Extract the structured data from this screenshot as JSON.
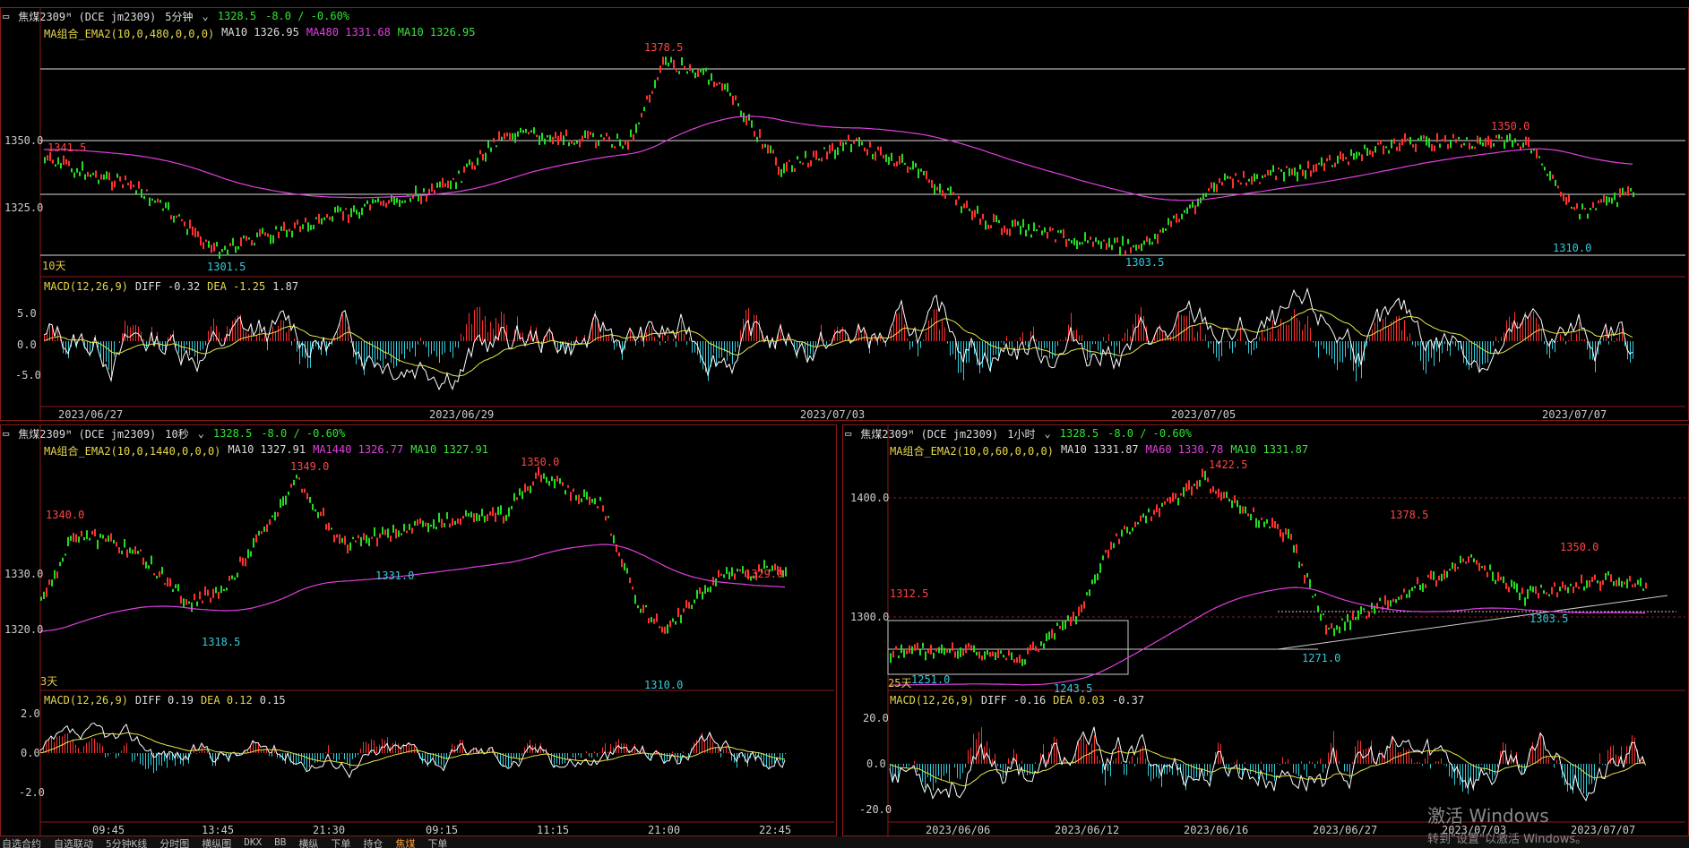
{
  "top": {
    "symbol": "焦煤2309ᴹ (DCE jm2309)",
    "period": "5分钟",
    "price": "1328.5",
    "change": "-8.0 / -0.60%",
    "legend": {
      "name": "MA组合_EMA2(10,0,480,0,0,0)",
      "ma10a": "MA10 1326.95",
      "ma480": "MA480 1331.68",
      "ma10b": "MA10 1326.95"
    },
    "yticks": [
      "1350.0",
      "1325.0"
    ],
    "annotations": {
      "high": "1378.5",
      "left": "1341.5",
      "low1": "1301.5",
      "low2": "1303.5",
      "r2": "1350.0",
      "last": "1310.0"
    },
    "days": "10天",
    "macd": {
      "name": "MACD(12,26,9)",
      "diff": "DIFF -0.32",
      "dea": "DEA -1.25",
      "val": "1.87",
      "yticks": [
        "5.0",
        "0.0",
        "-5.0"
      ]
    },
    "xticks": [
      "2023/06/27",
      "2023/06/29",
      "2023/07/03",
      "2023/07/05",
      "2023/07/07"
    ]
  },
  "bottom_left": {
    "symbol": "焦煤2309ᴹ (DCE jm2309)",
    "period": "10秒",
    "price": "1328.5",
    "change": "-8.0 / -0.60%",
    "legend": {
      "name": "MA组合_EMA2(10,0,1440,0,0,0)",
      "ma10a": "MA10 1327.91",
      "ma1440": "MA1440 1326.77",
      "ma10b": "MA10 1327.91"
    },
    "yticks": [
      "1330.0",
      "1320.0"
    ],
    "annotations": {
      "a1": "1340.0",
      "a2": "1349.0",
      "a3": "1350.0",
      "a4": "1329.0",
      "l1": "1318.5",
      "l2": "1331.0",
      "l3": "1310.0"
    },
    "days": "3天",
    "macd": {
      "name": "MACD(12,26,9)",
      "diff": "DIFF 0.19",
      "dea": "DEA 0.12",
      "val": "0.15",
      "yticks": [
        "2.0",
        "0.0",
        "-2.0"
      ]
    },
    "xticks": [
      "09:45",
      "13:45",
      "21:30",
      "09:15",
      "11:15",
      "21:00",
      "22:45"
    ]
  },
  "bottom_right": {
    "symbol": "焦煤2309ᴹ (DCE jm2309)",
    "period": "1小时",
    "price": "1328.5",
    "change": "-8.0 / -0.60%",
    "legend": {
      "name": "MA组合_EMA2(10,0,60,0,0,0)",
      "ma10a": "MA10 1331.87",
      "ma60": "MA60 1330.78",
      "ma10b": "MA10 1331.87"
    },
    "yticks": [
      "1400.0",
      "1300.0"
    ],
    "annotations": {
      "high": "1422.5",
      "a1": "1312.5",
      "a2": "1378.5",
      "a3": "1350.0",
      "l1": "1251.0",
      "l2": "1243.5",
      "l3": "1271.0",
      "l4": "1303.5"
    },
    "days": "25天",
    "macd": {
      "name": "MACD(12,26,9)",
      "diff": "DIFF -0.16",
      "dea": "DEA 0.03",
      "val": "-0.37",
      "yticks": [
        "20.0",
        "0.0",
        "-20.0"
      ]
    },
    "xticks": [
      "2023/06/06",
      "2023/06/12",
      "2023/06/16",
      "2023/06/27",
      "2023/07/03",
      "2023/07/07"
    ]
  },
  "statusbar": [
    "自选合约",
    "自选联动",
    "5分钟K线",
    "分时图",
    "横纵图",
    "DKX",
    "BB",
    "横纵",
    "下单",
    "持仓",
    "焦煤",
    "下单"
  ],
  "watermark": {
    "line1": "激活 Windows",
    "line2": "转到\"设置\"以激活 Windows。"
  },
  "colors": {
    "up": "#ff3030",
    "down": "#22dd22",
    "ema": "#e040e0",
    "ma10": "#e6e64a",
    "border": "#8b1a1a",
    "cyan": "#33ccdd"
  }
}
